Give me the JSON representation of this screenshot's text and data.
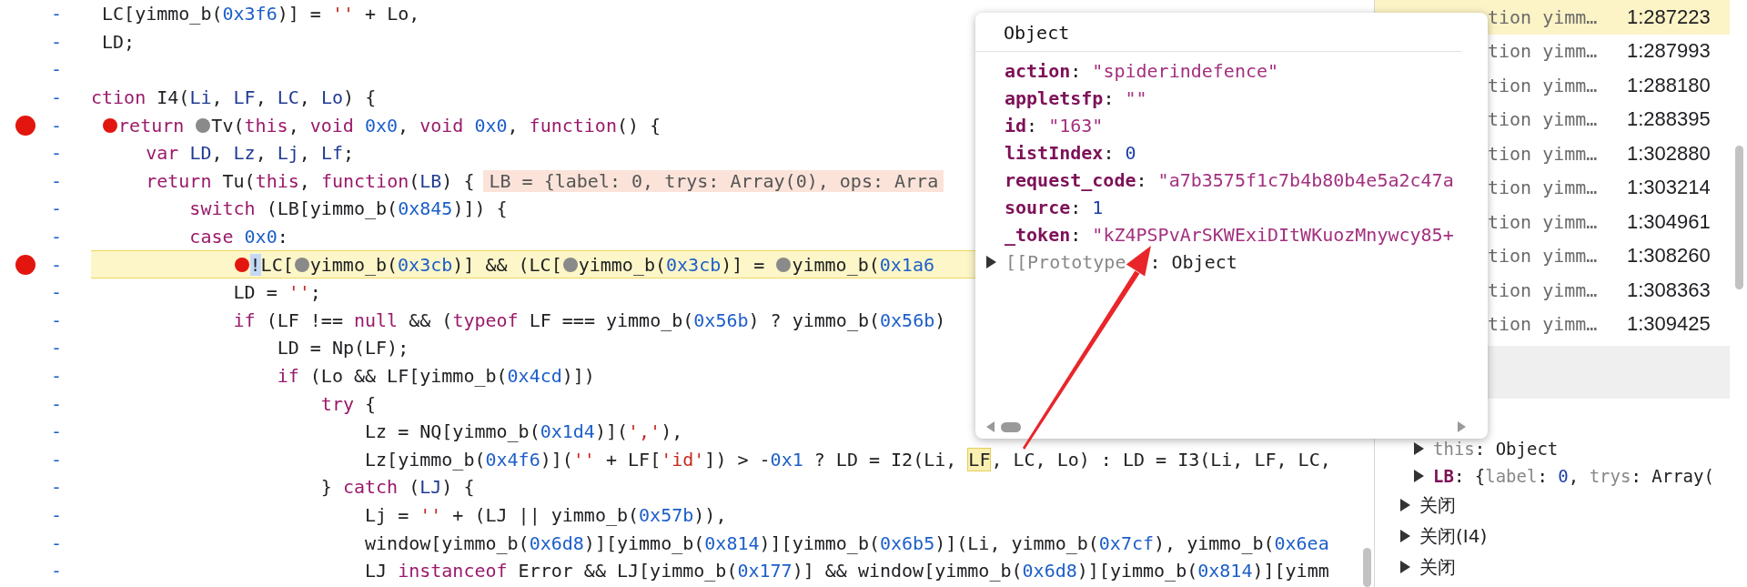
{
  "code_lines": [
    {
      "gutter": "-",
      "breakpoint": false,
      "current": false,
      "tokens": [
        {
          "text": " LC[yimmo_b("
        },
        {
          "text": "0x3f6",
          "kind": "num"
        },
        {
          "text": ")] = "
        },
        {
          "text": "''",
          "kind": "str"
        },
        {
          "text": " + Lo,"
        }
      ]
    },
    {
      "gutter": "-",
      "breakpoint": false,
      "current": false,
      "tokens": [
        {
          "text": " LD;"
        }
      ]
    },
    {
      "gutter": "-",
      "breakpoint": false,
      "current": false
    },
    {
      "gutter": "-",
      "breakpoint": false,
      "current": false,
      "tokens": [
        {
          "text": "ction",
          "kind": "kw"
        },
        {
          "text": " I4("
        },
        {
          "text": "Li",
          "kind": "def"
        },
        {
          "text": ", "
        },
        {
          "text": "LF",
          "kind": "def"
        },
        {
          "text": ", "
        },
        {
          "text": "LC",
          "kind": "def"
        },
        {
          "text": ", "
        },
        {
          "text": "Lo",
          "kind": "def"
        },
        {
          "text": ") {"
        }
      ]
    },
    {
      "gutter": "-",
      "breakpoint": true,
      "current": false,
      "tokens": [
        {
          "text": " return ",
          "kind": "kw",
          "marker": true,
          "enabled": true
        },
        {
          "text": "Tv(",
          "marker": true,
          "enabled": false
        },
        {
          "text": "this",
          "kind": "kw"
        },
        {
          "text": ", "
        },
        {
          "text": "void ",
          "kind": "kw"
        },
        {
          "text": "0x0",
          "kind": "num"
        },
        {
          "text": ", "
        },
        {
          "text": "void ",
          "kind": "kw"
        },
        {
          "text": "0x0",
          "kind": "num"
        },
        {
          "text": ", "
        },
        {
          "text": "function",
          "kind": "kw"
        },
        {
          "text": "() {"
        }
      ]
    },
    {
      "gutter": "-",
      "breakpoint": false,
      "current": false,
      "tokens": [
        {
          "text": "     var ",
          "kind": "kw"
        },
        {
          "text": "LD",
          "kind": "def"
        },
        {
          "text": ", "
        },
        {
          "text": "Lz",
          "kind": "def"
        },
        {
          "text": ", "
        },
        {
          "text": "Lj",
          "kind": "def"
        },
        {
          "text": ", "
        },
        {
          "text": "Lf",
          "kind": "def"
        },
        {
          "text": ";"
        }
      ]
    },
    {
      "gutter": "-",
      "breakpoint": false,
      "current": false,
      "tokens": [
        {
          "text": "     return",
          "kind": "kw"
        },
        {
          "text": " Tu("
        },
        {
          "text": "this",
          "kind": "kw"
        },
        {
          "text": ", "
        },
        {
          "text": "function",
          "kind": "kw"
        },
        {
          "text": "("
        },
        {
          "text": "LB",
          "kind": "def"
        },
        {
          "text": ") {"
        },
        {
          "text": "LB = {label: 0, trys: Array(0), ops: Arra",
          "kind": "inline"
        }
      ]
    },
    {
      "gutter": "-",
      "breakpoint": false,
      "current": false,
      "tokens": [
        {
          "text": "         switch",
          "kind": "kw"
        },
        {
          "text": " (LB[yimmo_b("
        },
        {
          "text": "0x845",
          "kind": "num"
        },
        {
          "text": ")]) {"
        }
      ]
    },
    {
      "gutter": "-",
      "breakpoint": false,
      "current": false,
      "tokens": [
        {
          "text": "         case ",
          "kind": "kw"
        },
        {
          "text": "0x0",
          "kind": "num"
        },
        {
          "text": ":"
        }
      ]
    },
    {
      "gutter": "-",
      "breakpoint": true,
      "current": true,
      "tokens": [
        {
          "text": "             !",
          "kind": "cursor",
          "marker": true,
          "enabled": true
        },
        {
          "text": "LC["
        },
        {
          "text": "yimmo_b(",
          "marker": true,
          "enabled": false
        },
        {
          "text": "0x3cb",
          "kind": "num"
        },
        {
          "text": ")] && (LC["
        },
        {
          "text": "yimmo_b(",
          "marker": true,
          "enabled": false
        },
        {
          "text": "0x3cb",
          "kind": "num"
        },
        {
          "text": ")] = "
        },
        {
          "text": "yimmo_b(",
          "marker": true,
          "enabled": false
        },
        {
          "text": "0x1a6",
          "kind": "num"
        }
      ]
    },
    {
      "gutter": "-",
      "breakpoint": false,
      "current": false,
      "tokens": [
        {
          "text": "             LD = "
        },
        {
          "text": "''",
          "kind": "str"
        },
        {
          "text": ";"
        }
      ]
    },
    {
      "gutter": "-",
      "breakpoint": false,
      "current": false,
      "tokens": [
        {
          "text": "             if",
          "kind": "kw"
        },
        {
          "text": " (LF !== "
        },
        {
          "text": "null",
          "kind": "kw"
        },
        {
          "text": " && ("
        },
        {
          "text": "typeof",
          "kind": "kw"
        },
        {
          "text": " LF === yimmo_b("
        },
        {
          "text": "0x56b",
          "kind": "num"
        },
        {
          "text": ") ? yimmo_b("
        },
        {
          "text": "0x56b",
          "kind": "num"
        },
        {
          "text": ")"
        }
      ]
    },
    {
      "gutter": "-",
      "breakpoint": false,
      "current": false,
      "tokens": [
        {
          "text": "                 LD = Np(LF);"
        }
      ]
    },
    {
      "gutter": "-",
      "breakpoint": false,
      "current": false,
      "tokens": [
        {
          "text": "                 if",
          "kind": "kw"
        },
        {
          "text": " (Lo && LF[yimmo_b("
        },
        {
          "text": "0x4cd",
          "kind": "num"
        },
        {
          "text": ")])"
        }
      ]
    },
    {
      "gutter": "-",
      "breakpoint": false,
      "current": false,
      "tokens": [
        {
          "text": "                     try",
          "kind": "kw"
        },
        {
          "text": " {"
        }
      ]
    },
    {
      "gutter": "-",
      "breakpoint": false,
      "current": false,
      "tokens": [
        {
          "text": "                         Lz = NQ[yimmo_b("
        },
        {
          "text": "0x1d4",
          "kind": "num"
        },
        {
          "text": ")]("
        },
        {
          "text": "','",
          "kind": "str"
        },
        {
          "text": "),"
        }
      ]
    },
    {
      "gutter": "-",
      "breakpoint": false,
      "current": false,
      "tokens": [
        {
          "text": "                         Lz[yimmo_b("
        },
        {
          "text": "0x4f6",
          "kind": "num"
        },
        {
          "text": ")]("
        },
        {
          "text": "''",
          "kind": "str"
        },
        {
          "text": " + LF["
        },
        {
          "text": "'id'",
          "kind": "str"
        },
        {
          "text": "]) > -"
        },
        {
          "text": "0x1",
          "kind": "num"
        },
        {
          "text": " ? LD = I2(Li, "
        },
        {
          "text": "LF",
          "kind": "match"
        },
        {
          "text": ", LC, Lo) : LD = I3(Li, LF, LC,"
        }
      ]
    },
    {
      "gutter": "-",
      "breakpoint": false,
      "current": false,
      "tokens": [
        {
          "text": "                     } "
        },
        {
          "text": "catch",
          "kind": "kw"
        },
        {
          "text": " ("
        },
        {
          "text": "LJ",
          "kind": "def"
        },
        {
          "text": ") {"
        }
      ]
    },
    {
      "gutter": "-",
      "breakpoint": false,
      "current": false,
      "tokens": [
        {
          "text": "                         Lj = "
        },
        {
          "text": "''",
          "kind": "str"
        },
        {
          "text": " + (LJ || yimmo_b("
        },
        {
          "text": "0x57b",
          "kind": "num"
        },
        {
          "text": ")),"
        }
      ]
    },
    {
      "gutter": "-",
      "breakpoint": false,
      "current": false,
      "tokens": [
        {
          "text": "                         window[yimmo_b("
        },
        {
          "text": "0x6d8",
          "kind": "num"
        },
        {
          "text": ")][yimmo_b("
        },
        {
          "text": "0x814",
          "kind": "num"
        },
        {
          "text": ")][yimmo_b("
        },
        {
          "text": "0x6b5",
          "kind": "num"
        },
        {
          "text": ")](Li, yimmo_b("
        },
        {
          "text": "0x7cf",
          "kind": "num"
        },
        {
          "text": "), yimmo_b("
        },
        {
          "text": "0x6ea",
          "kind": "num"
        }
      ]
    },
    {
      "gutter": "-",
      "breakpoint": false,
      "current": false,
      "tokens": [
        {
          "text": "                         LJ "
        },
        {
          "text": "instanceof",
          "kind": "kw"
        },
        {
          "text": " Error && LJ[yimmo_b("
        },
        {
          "text": "0x177",
          "kind": "num"
        },
        {
          "text": ")] && window[yimmo_b("
        },
        {
          "text": "0x6d8",
          "kind": "num"
        },
        {
          "text": ")][yimmo_b("
        },
        {
          "text": "0x814",
          "kind": "num"
        },
        {
          "text": ")][yimm"
        }
      ]
    }
  ],
  "popup": {
    "title": "Object",
    "properties": [
      {
        "tokens": [
          {
            "text": "action",
            "kind": "key"
          },
          {
            "text": ": "
          },
          {
            "text": "\"spiderindefence\"",
            "kind": "pstr"
          }
        ]
      },
      {
        "tokens": [
          {
            "text": "appletsfp",
            "kind": "key"
          },
          {
            "text": ": "
          },
          {
            "text": "\"\"",
            "kind": "pstr"
          }
        ]
      },
      {
        "tokens": [
          {
            "text": "id",
            "kind": "key"
          },
          {
            "text": ": "
          },
          {
            "text": "\"163\"",
            "kind": "pstr"
          }
        ]
      },
      {
        "tokens": [
          {
            "text": "listIndex",
            "kind": "key"
          },
          {
            "text": ": "
          },
          {
            "text": "0",
            "kind": "pnum"
          }
        ]
      },
      {
        "tokens": [
          {
            "text": "request_code",
            "kind": "key"
          },
          {
            "text": ": "
          },
          {
            "text": "\"a7b3575f1c7b4b80b4e5a2c47a",
            "kind": "pstr"
          }
        ]
      },
      {
        "tokens": [
          {
            "text": "source",
            "kind": "key"
          },
          {
            "text": ": "
          },
          {
            "text": "1",
            "kind": "pnum"
          }
        ]
      },
      {
        "tokens": [
          {
            "text": "_token",
            "kind": "key"
          },
          {
            "text": ": "
          },
          {
            "text": "\"kZ4PSPvArSKWExiDItWKuozMnywcy85+",
            "kind": "pstr"
          }
        ]
      }
    ],
    "prototype": {
      "expanded": false,
      "tokens": [
        {
          "text": "[[Prototype",
          "kind": "dim"
        },
        {
          "text": ": Object"
        }
      ]
    }
  },
  "call_stack": [
    {
      "function": "tion yimm…",
      "location": "1:287223",
      "selected": true
    },
    {
      "function": "tion yimm…",
      "location": "1:287993",
      "selected": false
    },
    {
      "function": "tion yimm…",
      "location": "1:288180",
      "selected": false
    },
    {
      "function": "tion yimm…",
      "location": "1:288395",
      "selected": false
    },
    {
      "function": "tion yimm…",
      "location": "1:302880",
      "selected": false
    },
    {
      "function": "tion yimm…",
      "location": "1:303214",
      "selected": false
    },
    {
      "function": "tion yimm…",
      "location": "1:304961",
      "selected": false
    },
    {
      "function": "tion yimm…",
      "location": "1:308260",
      "selected": false
    },
    {
      "function": "tion yimm…",
      "location": "1:308363",
      "selected": false
    },
    {
      "function": "tion yimm…",
      "location": "1:309425",
      "selected": false
    }
  ],
  "scope": {
    "entries": [
      {
        "expanded": false,
        "tokens": [
          {
            "text": "this",
            "kind": "dim"
          },
          {
            "text": ": Object"
          }
        ]
      },
      {
        "expanded": false,
        "tokens": [
          {
            "text": "LB",
            "kind": "key"
          },
          {
            "text": ": {"
          },
          {
            "text": "label",
            "kind": "dim"
          },
          {
            "text": ": "
          },
          {
            "text": "0",
            "kind": "pnum"
          },
          {
            "text": ", "
          },
          {
            "text": "trys",
            "kind": "dim"
          },
          {
            "text": ": Array("
          }
        ]
      }
    ],
    "closures": [
      {
        "expanded": false,
        "label": "关闭"
      },
      {
        "expanded": false,
        "label": "关闭(I4)"
      },
      {
        "expanded": false,
        "label": "关闭"
      }
    ]
  }
}
